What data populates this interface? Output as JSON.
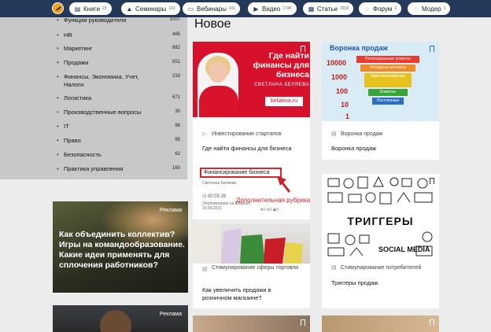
{
  "nav": {
    "pills": [
      {
        "icon": "book-icon",
        "glyph": "▤",
        "label": "Книги",
        "count": "23"
      },
      {
        "icon": "graduation-cap-icon",
        "glyph": "▲",
        "label": "Семинары",
        "count": "103"
      },
      {
        "icon": "monitor-icon",
        "glyph": "▭",
        "label": "Вебинары",
        "count": "201"
      },
      {
        "icon": "play-icon",
        "glyph": "▶",
        "label": "Видео",
        "count": "1748"
      },
      {
        "icon": "document-icon",
        "glyph": "▦",
        "label": "Статьи",
        "count": "2918"
      },
      {
        "icon": "chat-icon",
        "glyph": "◌",
        "label": "Форум",
        "count": "3"
      },
      {
        "icon": "chat-icon",
        "glyph": "◌",
        "label": "Модер",
        "count": "1"
      }
    ]
  },
  "sidebar": {
    "categories": [
      {
        "name": "Функции руководителя",
        "count": "1007"
      },
      {
        "name": "HR",
        "count": "485"
      },
      {
        "name": "Маркетинг",
        "count": "982"
      },
      {
        "name": "Продажи",
        "count": "651"
      },
      {
        "name": "Финансы, Экономика, Учет, Налоги",
        "count": "233"
      },
      {
        "name": "Логистика",
        "count": "671"
      },
      {
        "name": "Производственные вопросы",
        "count": "30"
      },
      {
        "name": "IT",
        "count": "98"
      },
      {
        "name": "Право",
        "count": "95"
      },
      {
        "name": "Безопасность",
        "count": "62"
      },
      {
        "name": "Практика управления",
        "count": "160"
      }
    ]
  },
  "ads": [
    {
      "tag": "Реклама",
      "title": "Как объединить коллектив? Игры на командообразование. Какие идеи применять для сплочения работников?"
    },
    {
      "tag": "Реклама"
    }
  ],
  "main": {
    "heading": "Новое",
    "cards": [
      {
        "image_title": "Где найти финансы для бизнеса",
        "image_author": "СВЕТЛАНА БЕЛЯЕВА",
        "image_site": "beliaeva.ru",
        "rubric": "Инвестирование стартапов",
        "title": "Где найти финансы для бизнеса",
        "tag": "Финансирование бизнеса",
        "author": "Светлана Беляева",
        "duration": "00:05:26",
        "published": "Опубликовано на Elitarium 10.09.2021",
        "likes": "3",
        "comments": "0",
        "views": "0"
      },
      {
        "image_title": "Воронка продаж",
        "funnel_numbers": [
          "10000",
          "1000",
          "100",
          "10",
          "1"
        ],
        "funnel_steps": [
          "Потенциальные клиенты",
          "Холодные контакты",
          "Заинтересованные",
          "Клиенты",
          "Постоянные"
        ],
        "rubric": "Воронка продаж",
        "title": "Воронка продаж"
      },
      {
        "rubric": "Стимулирование сферы торговли",
        "title": "Как увеличить продажи в розничном магазине?"
      },
      {
        "image_title": "ТРИГГЕРЫ",
        "image_sub": "SOCIAL MEDIA",
        "rubric": "Стимулирование потребителей",
        "title": "Триггеры продаж"
      }
    ]
  },
  "annotation": {
    "text": "Дополнительная рубрика",
    "color": "#c8222a"
  },
  "colors": {
    "topbar": "#24395a",
    "accent_red": "#d7102b"
  }
}
